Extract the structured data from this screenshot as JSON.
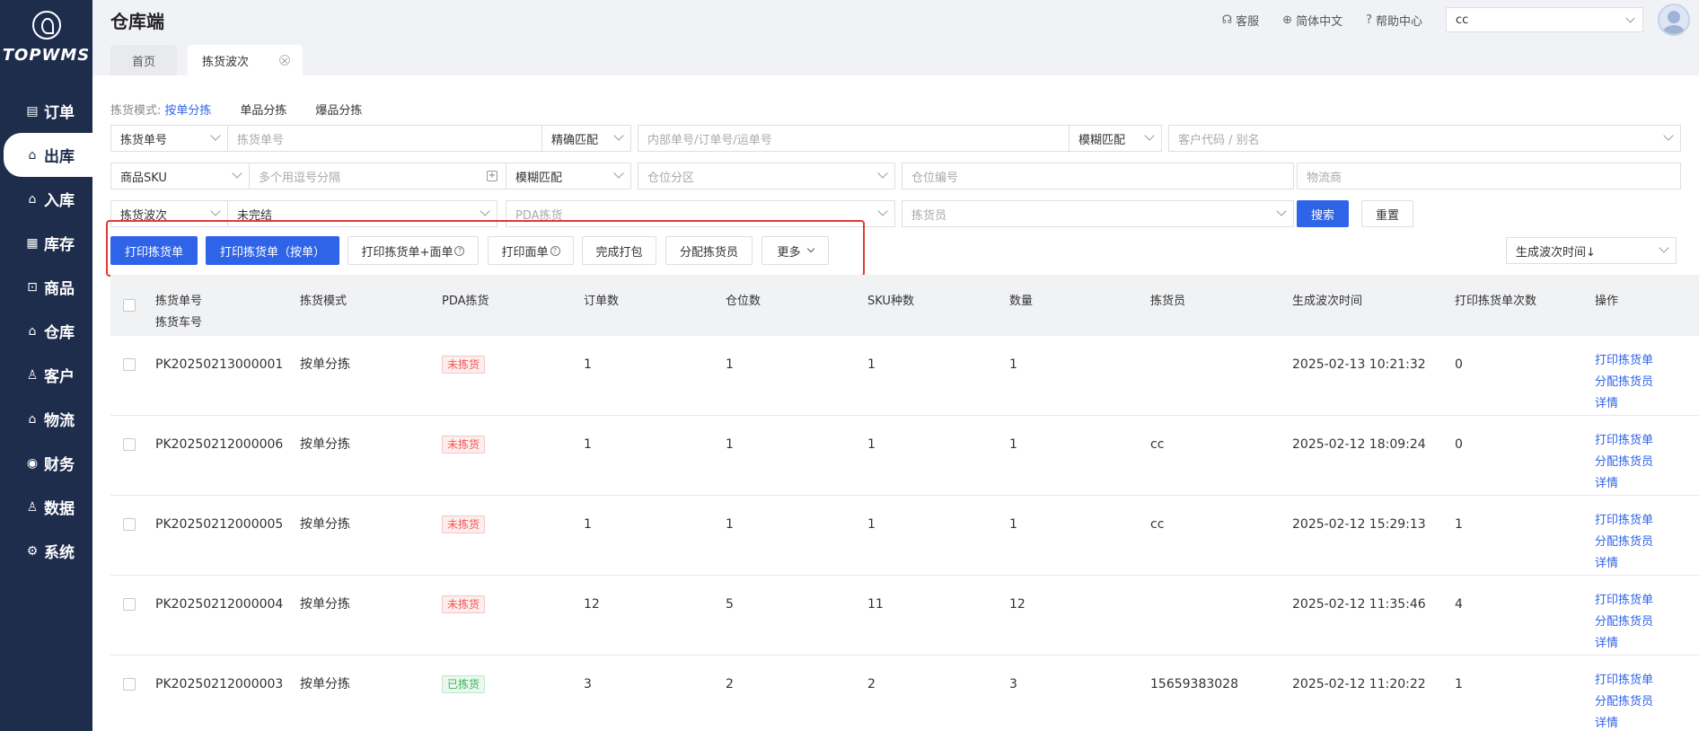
{
  "app": {
    "logo_text": "TOPWMS",
    "title": "仓库端"
  },
  "header": {
    "links": [
      {
        "icon": "headset-icon",
        "glyph": "☊",
        "label": "客服"
      },
      {
        "icon": "globe-icon",
        "glyph": "⊕",
        "label": "简体中文"
      },
      {
        "icon": "help-icon",
        "glyph": "?",
        "label": "帮助中心"
      }
    ],
    "warehouse_value": "cc"
  },
  "sidebar": {
    "items": [
      {
        "icon": "order-icon",
        "glyph": "▤",
        "label": "订单"
      },
      {
        "icon": "outbound-icon",
        "glyph": "⌂",
        "label": "出库"
      },
      {
        "icon": "inbound-icon",
        "glyph": "⌂",
        "label": "入库"
      },
      {
        "icon": "inventory-icon",
        "glyph": "▦",
        "label": "库存"
      },
      {
        "icon": "goods-icon",
        "glyph": "⊡",
        "label": "商品"
      },
      {
        "icon": "warehouse-icon",
        "glyph": "⌂",
        "label": "仓库"
      },
      {
        "icon": "customer-icon",
        "glyph": "♙",
        "label": "客户"
      },
      {
        "icon": "logistics-icon",
        "glyph": "⌂",
        "label": "物流"
      },
      {
        "icon": "finance-icon",
        "glyph": "◉",
        "label": "财务"
      },
      {
        "icon": "data-icon",
        "glyph": "♙",
        "label": "数据"
      },
      {
        "icon": "system-icon",
        "glyph": "⚙",
        "label": "系统"
      }
    ],
    "active_index": 1
  },
  "tabs": [
    {
      "label": "首页"
    },
    {
      "label": "拣货波次"
    }
  ],
  "mode": {
    "label": "拣货模式:",
    "options": [
      "按单分拣",
      "单品分拣",
      "爆品分拣"
    ]
  },
  "filters": {
    "pick_no_type": "拣货单号",
    "pick_no_placeholder": "拣货单号",
    "match1": "精确匹配",
    "order_no_placeholder": "内部单号/订单号/运单号",
    "match2": "模糊匹配",
    "customer_placeholder": "客户代码 / 别名",
    "sku_type": "商品SKU",
    "sku_placeholder": "多个用逗号分隔",
    "match3": "模糊匹配",
    "zone_placeholder": "仓位分区",
    "location_placeholder": "仓位编号",
    "carrier_placeholder": "物流商",
    "wave_type": "拣货波次",
    "wave_value": "未完结",
    "pda_placeholder": "PDA拣货",
    "picker_placeholder": "拣货员",
    "search": "搜索",
    "reset": "重置"
  },
  "actions": {
    "print_pick": "打印拣货单",
    "print_pick_by_order": "打印拣货单（按单）",
    "print_pick_waybill": "打印拣货单+面单",
    "print_waybill": "打印面单",
    "finish_pack": "完成打包",
    "assign_picker": "分配拣货员",
    "more": "更多"
  },
  "sort": {
    "value": "生成波次时间↓"
  },
  "table": {
    "headers": {
      "pick_no": "拣货单号",
      "cart_no": "拣货车号",
      "mode": "拣货模式",
      "pda": "PDA拣货",
      "orders": "订单数",
      "locations": "仓位数",
      "sku": "SKU种数",
      "qty": "数量",
      "picker": "拣货员",
      "created": "生成波次时间",
      "print_count": "打印拣货单次数",
      "ops": "操作"
    },
    "op_labels": {
      "print": "打印拣货单",
      "assign": "分配拣货员",
      "detail": "详情"
    },
    "rows": [
      {
        "pick_no": "PK20250213000001",
        "mode": "按单分拣",
        "pda": "未拣货",
        "pda_done": false,
        "orders": "1",
        "locations": "1",
        "sku": "1",
        "qty": "1",
        "picker": "",
        "created": "2025-02-13 10:21:32",
        "print_count": "0"
      },
      {
        "pick_no": "PK20250212000006",
        "mode": "按单分拣",
        "pda": "未拣货",
        "pda_done": false,
        "orders": "1",
        "locations": "1",
        "sku": "1",
        "qty": "1",
        "picker": "cc",
        "created": "2025-02-12 18:09:24",
        "print_count": "0"
      },
      {
        "pick_no": "PK20250212000005",
        "mode": "按单分拣",
        "pda": "未拣货",
        "pda_done": false,
        "orders": "1",
        "locations": "1",
        "sku": "1",
        "qty": "1",
        "picker": "cc",
        "created": "2025-02-12 15:29:13",
        "print_count": "1"
      },
      {
        "pick_no": "PK20250212000004",
        "mode": "按单分拣",
        "pda": "未拣货",
        "pda_done": false,
        "orders": "12",
        "locations": "5",
        "sku": "11",
        "qty": "12",
        "picker": "",
        "created": "2025-02-12 11:35:46",
        "print_count": "4"
      },
      {
        "pick_no": "PK20250212000003",
        "mode": "按单分拣",
        "pda": "已拣货",
        "pda_done": true,
        "orders": "3",
        "locations": "2",
        "sku": "2",
        "qty": "3",
        "picker": "15659383028",
        "created": "2025-02-12 11:20:22",
        "print_count": "1"
      }
    ]
  }
}
